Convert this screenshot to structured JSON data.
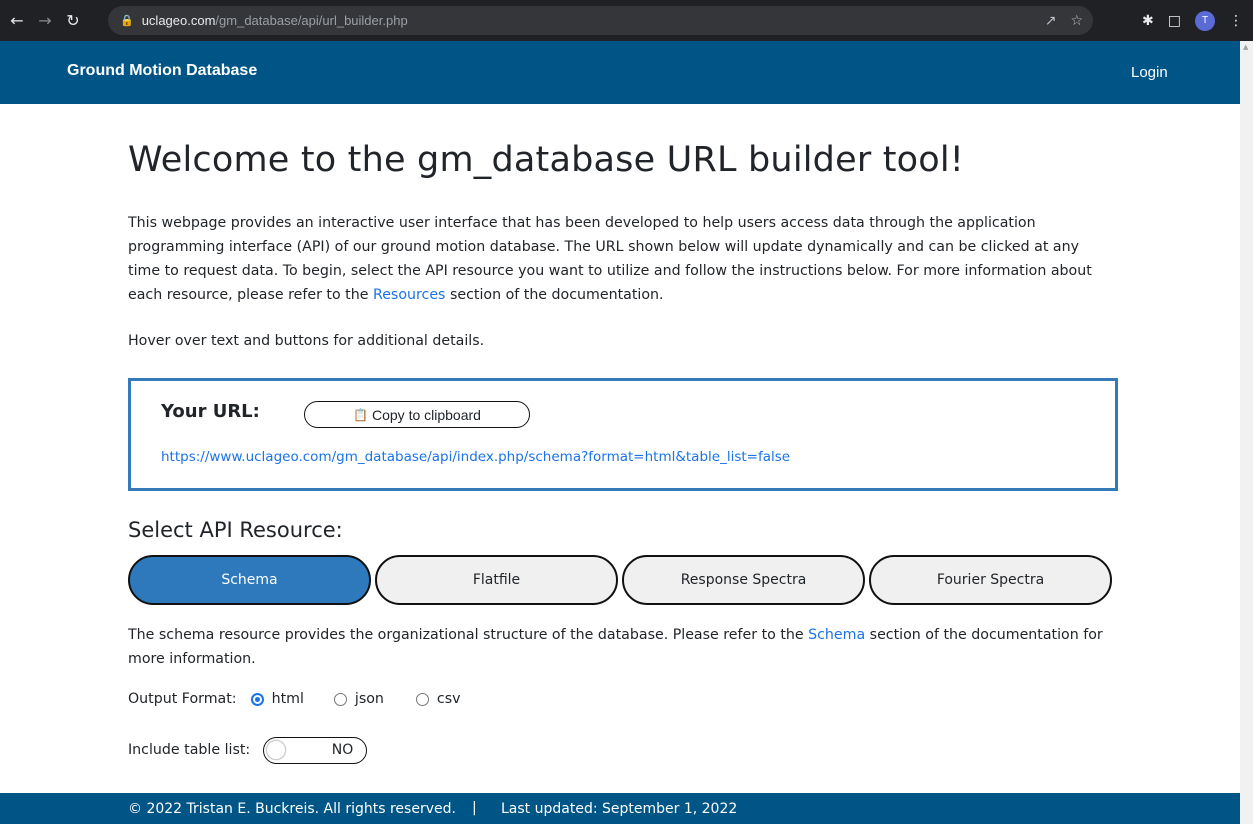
{
  "browser": {
    "url_host": "uclageo.com",
    "url_path": "/gm_database/api/url_builder.php",
    "profile_initial": "T"
  },
  "header": {
    "brand": "Ground Motion Database",
    "login": "Login"
  },
  "main": {
    "title": "Welcome to the gm_database URL builder tool!",
    "intro_text": "This webpage provides an interactive user interface that has been developed to help users access data through the application programming interface (API) of our ground motion database. The URL shown below will update dynamically and can be clicked at any time to request data. To begin, select the API resource you want to utilize and follow the instructions below. For more information about each resource, please refer to the ",
    "intro_link": "Resources",
    "intro_tail": " section of the documentation.",
    "hover_note": "Hover over text and buttons for additional details.",
    "url_box": {
      "label": "Your URL:",
      "copy_button": "Copy to clipboard",
      "url": "https://www.uclageo.com/gm_database/api/index.php/schema?format=html&table_list=false"
    },
    "resource_title": "Select API Resource:",
    "resources": [
      {
        "label": "Schema",
        "active": true
      },
      {
        "label": "Flatfile",
        "active": false
      },
      {
        "label": "Response Spectra",
        "active": false
      },
      {
        "label": "Fourier Spectra",
        "active": false
      }
    ],
    "description_start": "The schema resource provides the organizational structure of the database. Please refer to the ",
    "description_link": "Schema",
    "description_end": " section of the documentation for more information.",
    "output_format": {
      "label": "Output Format:",
      "options": [
        "html",
        "json",
        "csv"
      ],
      "selected": "html"
    },
    "table_list": {
      "label": "Include table list:",
      "value": "NO"
    }
  },
  "footer": {
    "copyright": "© 2022 Tristan E. Buckreis. All rights reserved.",
    "separator": "|",
    "updated": "Last updated: September 1, 2022"
  },
  "colors": {
    "header_bg": "#005587",
    "active_button": "#2d79bb",
    "link": "#1a73e8",
    "url_box_border": "#3479b8"
  }
}
